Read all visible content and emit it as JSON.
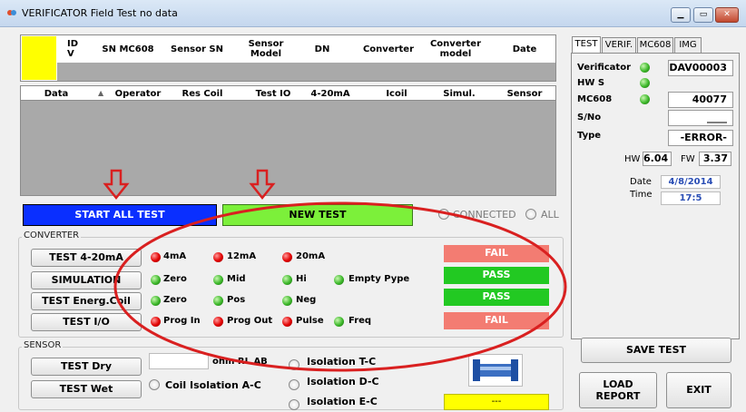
{
  "window": {
    "title": "VERIFICATOR Field Test no data",
    "min_icon": "minimize-icon",
    "max_icon": "maximize-icon",
    "close_icon": "close-icon"
  },
  "top_table": {
    "headers": [
      "ID\nV",
      "SN MC608",
      "Sensor SN",
      "Sensor\nModel",
      "DN",
      "Converter",
      "Converter\nmodel",
      "Date"
    ]
  },
  "data_table": {
    "headers": [
      "Data",
      "Operator",
      "Res Coil",
      "Test IO",
      "4-20mA",
      "Icoil",
      "Simul.",
      "Sensor"
    ]
  },
  "actions": {
    "start_all": "START ALL TEST",
    "new_test": "NEW TEST",
    "connected": "CONNECTED",
    "all": "ALL"
  },
  "converter": {
    "label": "CONVERTER",
    "rows": [
      {
        "button": "TEST 4-20mA",
        "leds": [
          {
            "color": "red",
            "label": "4mA"
          },
          {
            "color": "red",
            "label": "12mA"
          },
          {
            "color": "red",
            "label": "20mA"
          }
        ],
        "result": "FAIL"
      },
      {
        "button": "SIMULATION",
        "leds": [
          {
            "color": "green",
            "label": "Zero"
          },
          {
            "color": "green",
            "label": "Mid"
          },
          {
            "color": "green",
            "label": "Hi"
          },
          {
            "color": "green",
            "label": "Empty Pype"
          }
        ],
        "result": "PASS"
      },
      {
        "button": "TEST Energ.Coil",
        "leds": [
          {
            "color": "green",
            "label": "Zero"
          },
          {
            "color": "green",
            "label": "Pos"
          },
          {
            "color": "green",
            "label": "Neg"
          }
        ],
        "result": "PASS"
      },
      {
        "button": "TEST I/O",
        "leds": [
          {
            "color": "red",
            "label": "Prog In"
          },
          {
            "color": "red",
            "label": "Prog Out"
          },
          {
            "color": "red",
            "label": "Pulse"
          },
          {
            "color": "green",
            "label": "Freq"
          }
        ],
        "result": "FAIL"
      }
    ]
  },
  "sensor": {
    "label": "SENSOR",
    "test_dry": "TEST Dry",
    "test_wet": "TEST Wet",
    "ohm_label": "ohm RL AB",
    "coil_isolation": "Coil Isolation A-C",
    "isolation_tc": "Isolation T-C",
    "isolation_dc": "Isolation D-C",
    "isolation_ec": "Isolation E-C",
    "status_value": "---"
  },
  "side": {
    "tabs": [
      "TEST",
      "VERIF.",
      "MC608",
      "IMG"
    ],
    "verificator_label": "Verificator",
    "verificator_value": "DAV00003",
    "hws_label": "HW S",
    "mc608_label": "MC608",
    "mc608_value": "40077",
    "sno_label": "S/No",
    "sno_value": "____",
    "type_label": "Type",
    "type_value": "-ERROR-",
    "hw_label": "HW",
    "hw_value": "6.04",
    "fw_label": "FW",
    "fw_value": "3.37",
    "date_label": "Date",
    "date_value": "4/8/2014",
    "time_label": "Time",
    "time_value": "17:5",
    "save_test": "SAVE TEST",
    "load_report": "LOAD\nREPORT",
    "exit": "EXIT"
  },
  "colors": {
    "start_btn": "#0a2fff",
    "new_btn": "#7cf03a",
    "fail": "#f37c72",
    "pass": "#22c922",
    "annotation": "#d92020",
    "yellow": "#ffff00"
  }
}
